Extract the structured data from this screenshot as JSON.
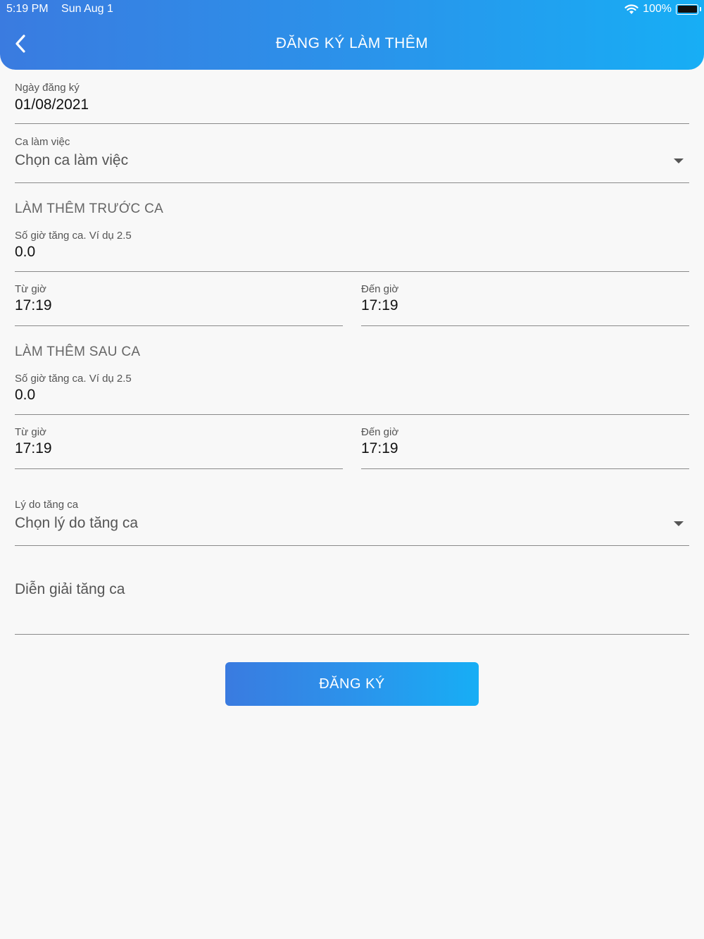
{
  "status_bar": {
    "time": "5:19 PM",
    "date": "Sun Aug 1",
    "battery": "100%"
  },
  "header": {
    "title": "ĐĂNG KÝ LÀM THÊM"
  },
  "form": {
    "date": {
      "label": "Ngày đăng ký",
      "value": "01/08/2021"
    },
    "shift": {
      "label": "Ca làm việc",
      "placeholder": "Chọn ca làm việc"
    },
    "before_shift": {
      "section_title": "LÀM THÊM TRƯỚC CA",
      "hours": {
        "label": "Số giờ tăng ca. Ví dụ 2.5",
        "value": "0.0"
      },
      "from": {
        "label": "Từ giờ",
        "value": "17:19"
      },
      "to": {
        "label": "Đến giờ",
        "value": "17:19"
      }
    },
    "after_shift": {
      "section_title": "LÀM THÊM SAU CA",
      "hours": {
        "label": "Số giờ tăng ca. Ví dụ 2.5",
        "value": "0.0"
      },
      "from": {
        "label": "Từ giờ",
        "value": "17:19"
      },
      "to": {
        "label": "Đến giờ",
        "value": "17:19"
      }
    },
    "reason": {
      "label": "Lý do tăng ca",
      "placeholder": "Chọn lý do tăng ca"
    },
    "explanation": {
      "placeholder": "Diễn giải tăng ca"
    },
    "submit_label": "ĐĂNG KÝ"
  },
  "colors": {
    "header_start": "#3a7be0",
    "header_end": "#17aef5",
    "background": "#f8f8f8"
  },
  "icons": {
    "back": "chevron-left-icon",
    "wifi": "wifi-icon",
    "battery": "battery-icon",
    "dropdown": "caret-down-icon"
  }
}
